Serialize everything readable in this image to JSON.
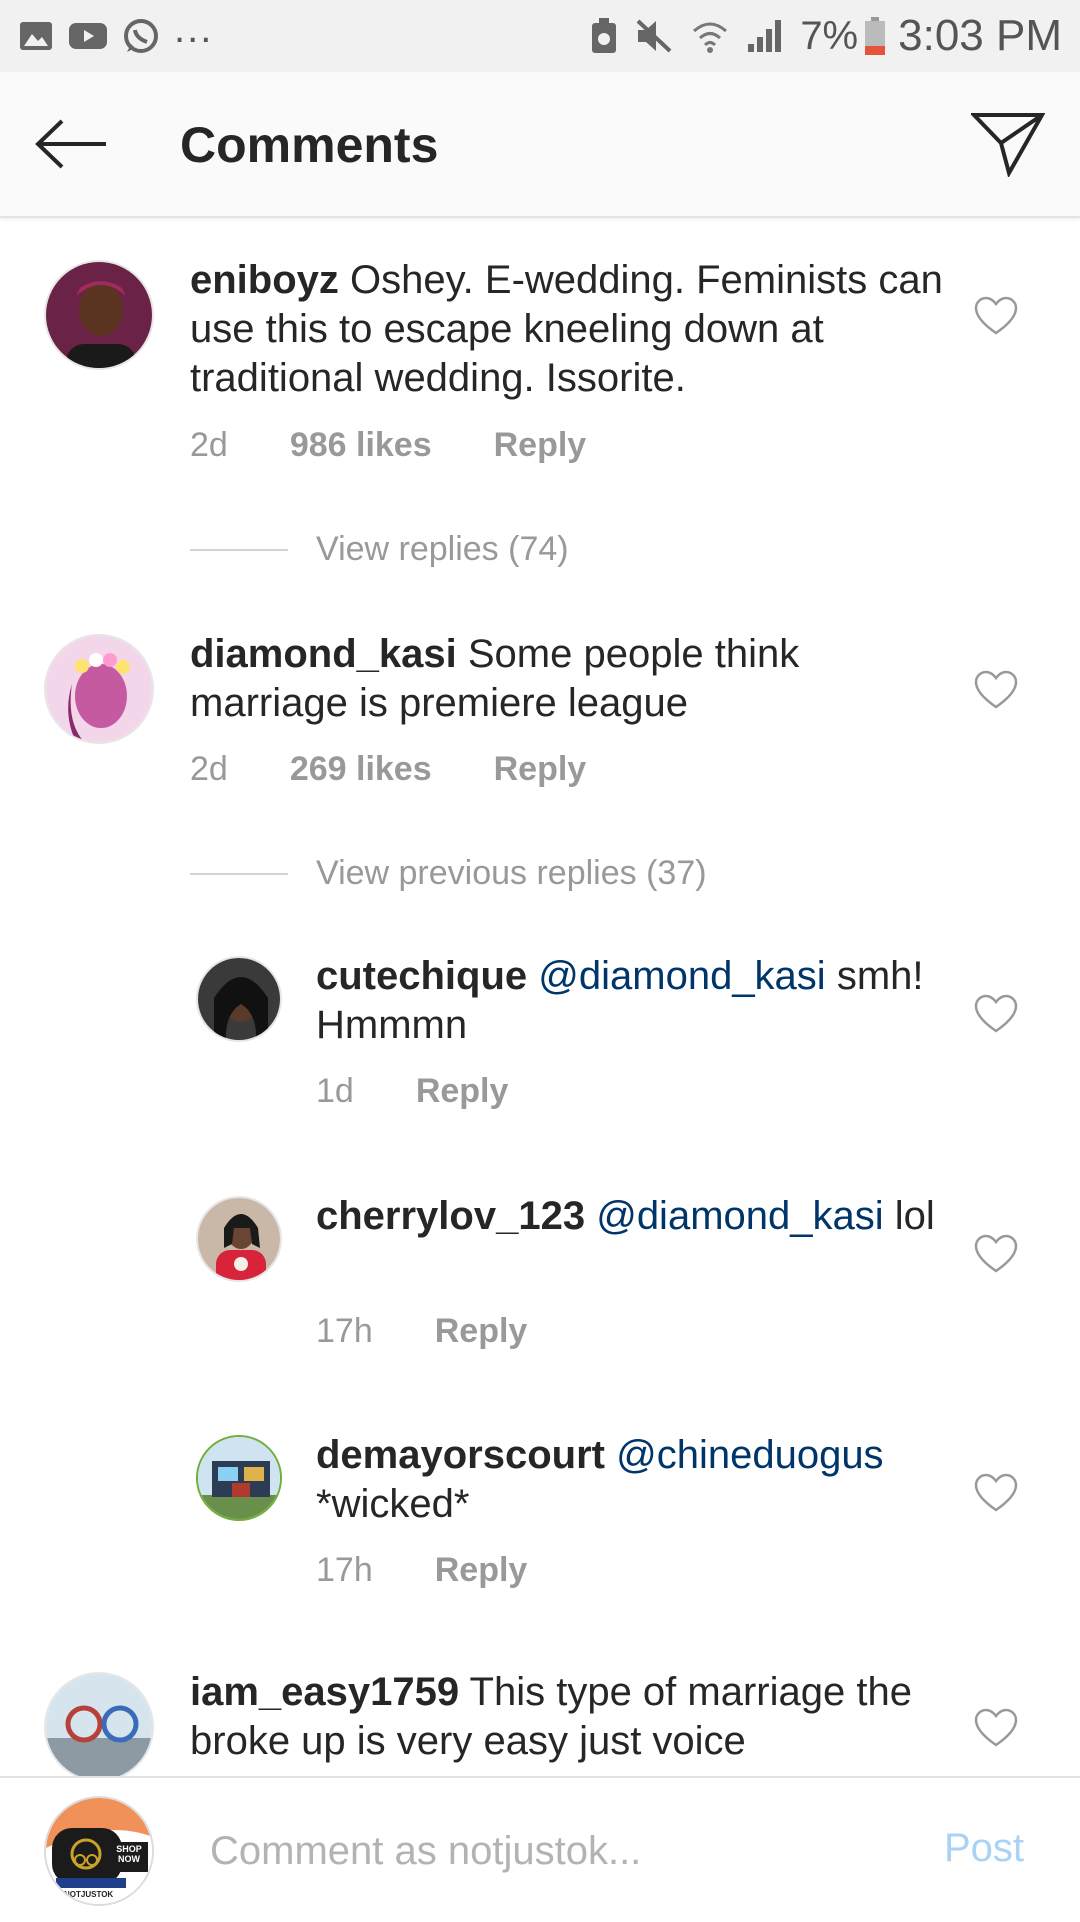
{
  "status_bar": {
    "battery": "7%",
    "time": "3:03 PM",
    "dots": "..."
  },
  "header": {
    "title": "Comments"
  },
  "comments": [
    {
      "username": "eniboyz",
      "text": " Oshey. E-wedding. Feminists can use this to escape kneeling down at traditional wedding.  Issorite.",
      "time": "2d",
      "likes": "986 likes",
      "reply": "Reply",
      "view_replies": "View replies (74)"
    },
    {
      "username": "diamond_kasi",
      "text": " Some people think marriage is premiere league",
      "time": "2d",
      "likes": "269 likes",
      "reply": "Reply",
      "view_replies": "View previous replies (37)",
      "replies": [
        {
          "username": "cutechique",
          "mention": " @diamond_kasi",
          "text": " smh! Hmmmn",
          "time": "1d",
          "reply": "Reply"
        },
        {
          "username": "cherrylov_123",
          "mention": " @diamond_kasi",
          "text": " lol",
          "time": "17h",
          "reply": "Reply"
        },
        {
          "username": "demayorscourt",
          "mention": " @chineduogus",
          "text": " *wicked*",
          "time": "17h",
          "reply": "Reply"
        }
      ]
    },
    {
      "username": "iam_easy1759",
      "text": " This type of marriage the broke up is very easy just voice"
    }
  ],
  "composer": {
    "placeholder": "Comment as notjustok...",
    "post": "Post",
    "avatar_text": "SHOP NOW",
    "avatar_brand": "NOTJUSTOK"
  },
  "colors": {
    "mention": "#003569",
    "meta": "#999999",
    "post_disabled": "#a9d2f5"
  }
}
